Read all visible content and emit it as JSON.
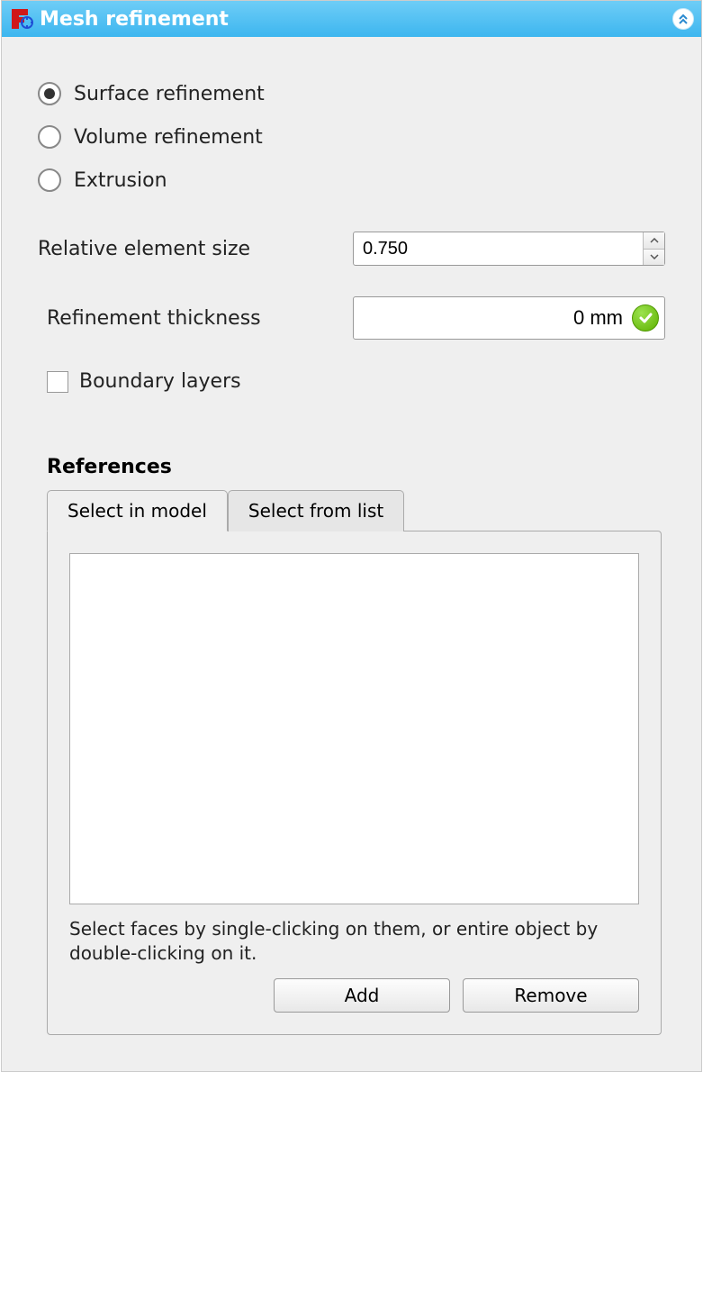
{
  "titlebar": {
    "title": "Mesh refinement"
  },
  "refinement_type": {
    "options": [
      {
        "label": "Surface refinement",
        "selected": true
      },
      {
        "label": "Volume refinement",
        "selected": false
      },
      {
        "label": "Extrusion",
        "selected": false
      }
    ]
  },
  "relative_element_size": {
    "label": "Relative element size",
    "value": "0.750"
  },
  "refinement_thickness": {
    "label": "Refinement thickness",
    "value": "0 mm"
  },
  "boundary_layers": {
    "label": "Boundary layers",
    "checked": false
  },
  "references": {
    "title": "References",
    "tabs": [
      {
        "label": "Select in model",
        "active": true
      },
      {
        "label": "Select from list",
        "active": false
      }
    ],
    "help_text": "Select faces by single-clicking on them, or entire object by double-clicking on it.",
    "add_label": "Add",
    "remove_label": "Remove"
  }
}
